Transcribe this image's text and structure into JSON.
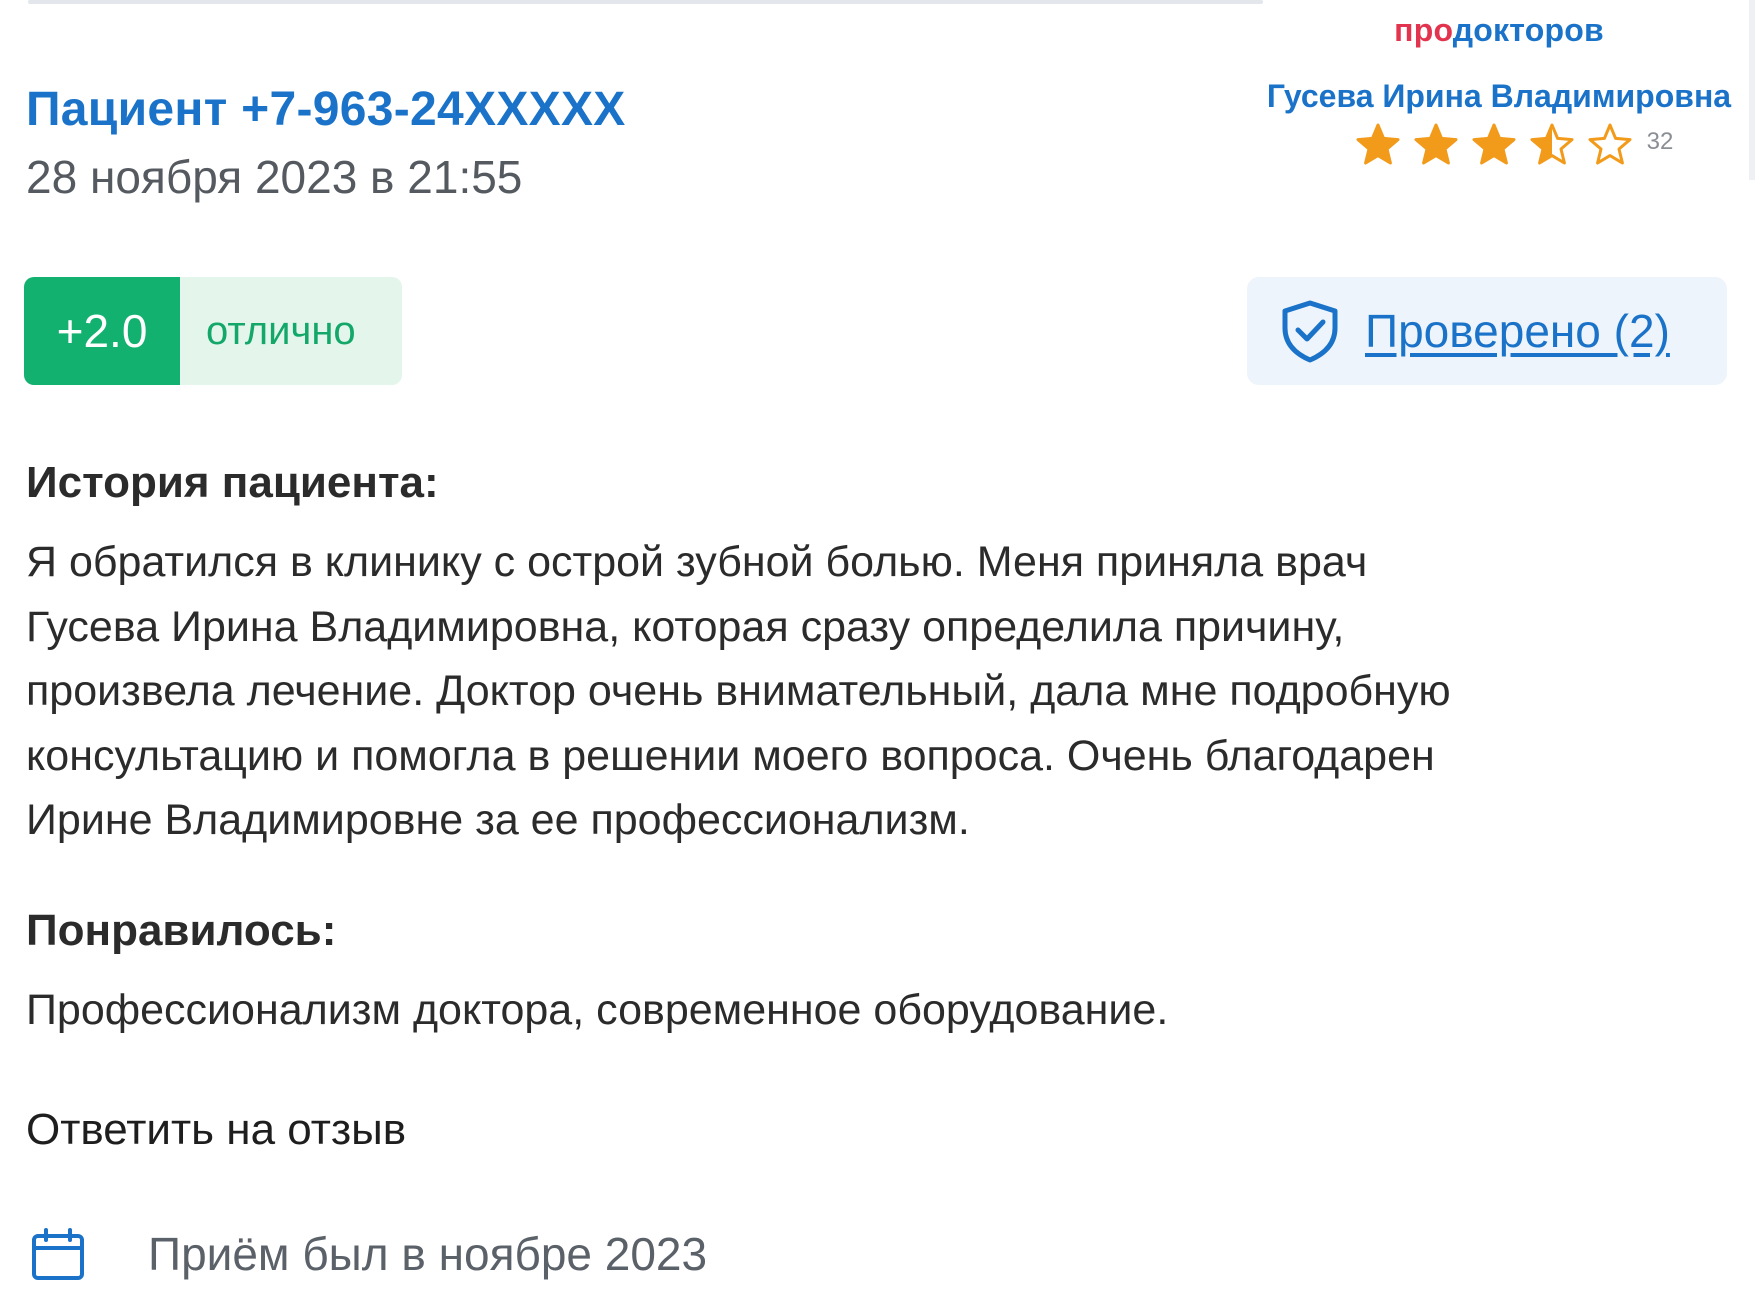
{
  "review": {
    "author": "Пациент +7-963-24XXXXX",
    "date": "28 ноября 2023 в 21:55",
    "score_value": "+2.0",
    "score_label": "отлично",
    "verified_label": "Проверено (2)",
    "history_title": "История пациента:",
    "history_lines": [
      "Я обратился в клинику с острой зубной болью. Меня приняла врач",
      "Гусева Ирина Владимировна, которая сразу определила причину,",
      "произвела лечение. Доктор очень внимательный, дала мне подробную",
      "консультацию и помогла в решении моего вопроса. Очень благодарен",
      "Ирине Владимировне за ее профессионализм."
    ],
    "liked_title": "Понравилось:",
    "liked_text": "Профессионализм доктора, современное оборудование.",
    "reply_label": "Ответить на отзыв",
    "visit_text": "Приём был в ноябре 2023"
  },
  "widget": {
    "brand_pro": "про",
    "brand_doctors": "докторов",
    "doctor_name": "Гусева Ирина Владимировна",
    "rating_stars": 3.5,
    "rating_max": 5,
    "reviews_count": "32"
  },
  "icons": {
    "verified": "shield-check-icon",
    "visit": "calendar-icon",
    "star": "star-icon"
  },
  "colors": {
    "link_blue": "#1a73c8",
    "brand_red": "#e3344f",
    "score_green": "#12b16f",
    "score_bg": "#e4f5ec",
    "star_orange": "#f29a1a",
    "verified_bg": "#eef4fb"
  }
}
